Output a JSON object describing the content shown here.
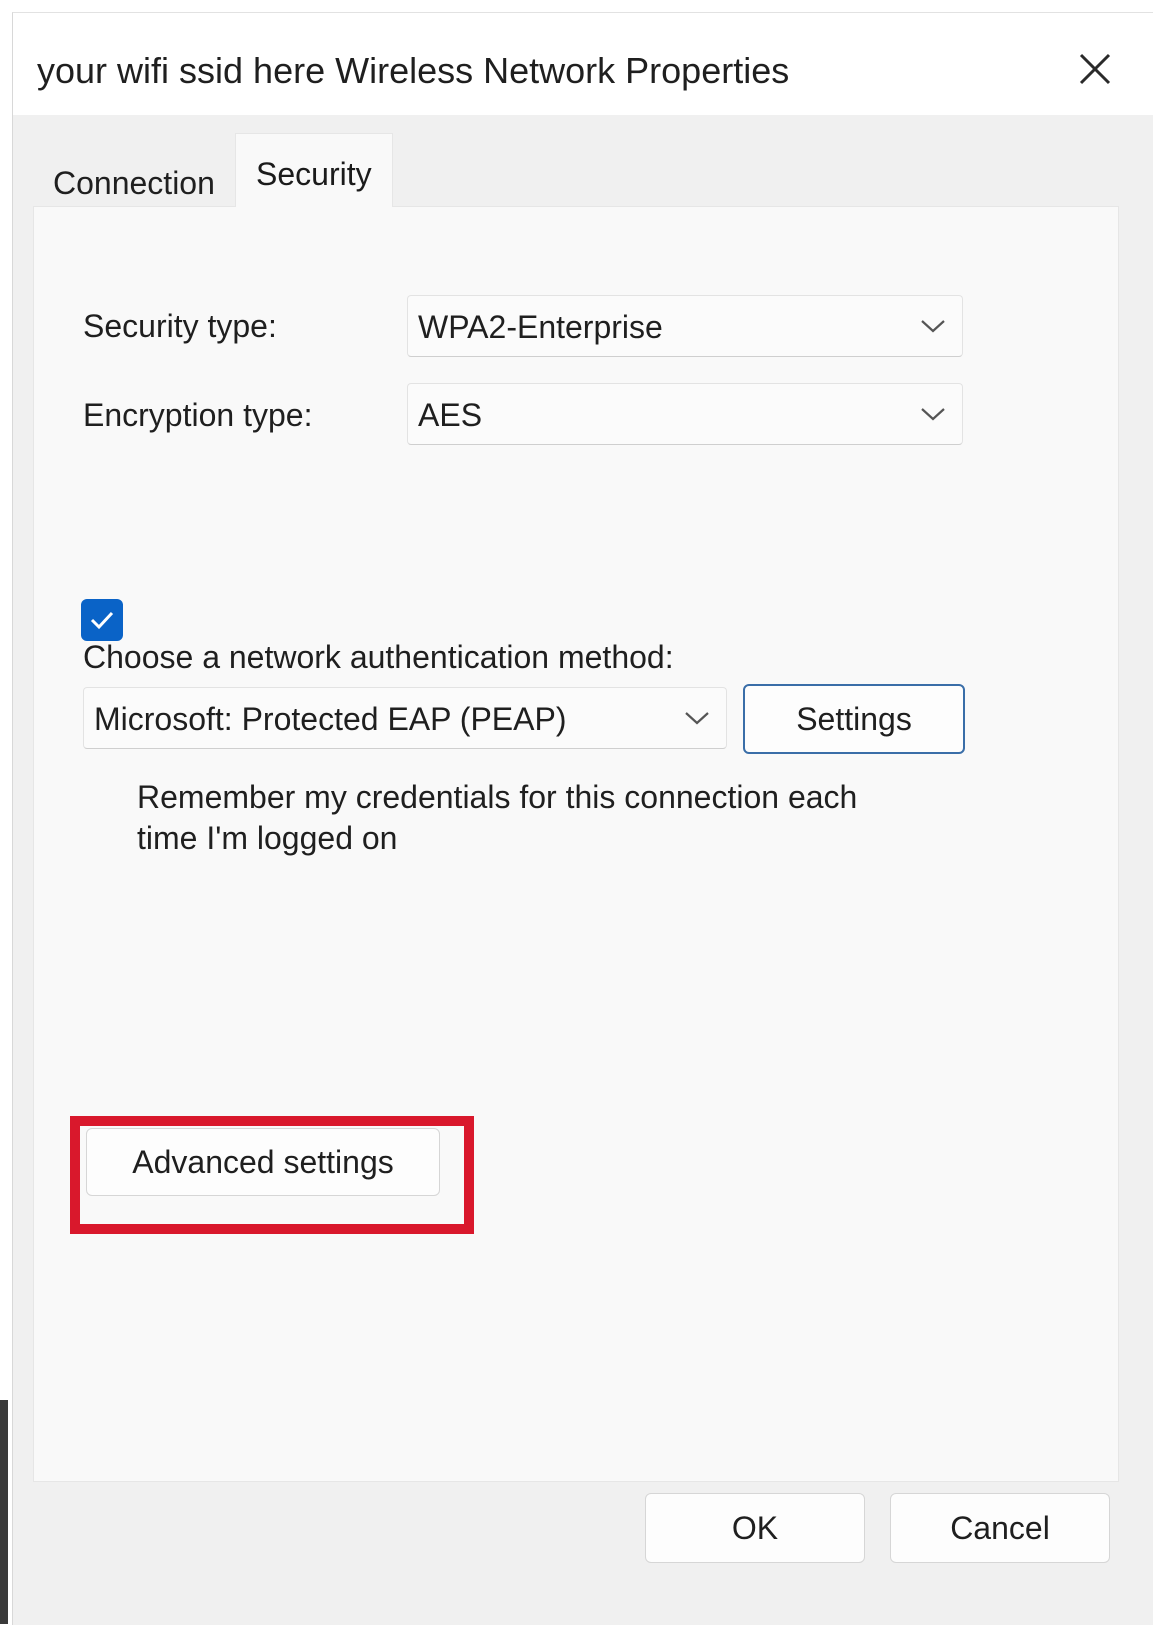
{
  "window": {
    "title": "your wifi ssid here Wireless Network Properties",
    "close_icon": "close-icon"
  },
  "tabs": [
    {
      "label": "Connection",
      "selected": false
    },
    {
      "label": "Security",
      "selected": true
    }
  ],
  "security": {
    "security_type_label": "Security type:",
    "security_type_value": "WPA2-Enterprise",
    "encryption_type_label": "Encryption type:",
    "encryption_type_value": "AES",
    "auth_method_label": "Choose a network authentication method:",
    "auth_method_value": "Microsoft: Protected EAP (PEAP)",
    "settings_label": "Settings",
    "remember_credentials_line1": "Remember my credentials for this connection each",
    "remember_credentials_line2": "time I'm logged on",
    "remember_credentials_checked": true,
    "advanced_settings_label": "Advanced settings"
  },
  "footer": {
    "ok_label": "OK",
    "cancel_label": "Cancel"
  },
  "colors": {
    "accent": "#0a63c7",
    "highlight": "#d9182c",
    "background": "#f0f0f0",
    "panel": "#f9f9f9"
  }
}
